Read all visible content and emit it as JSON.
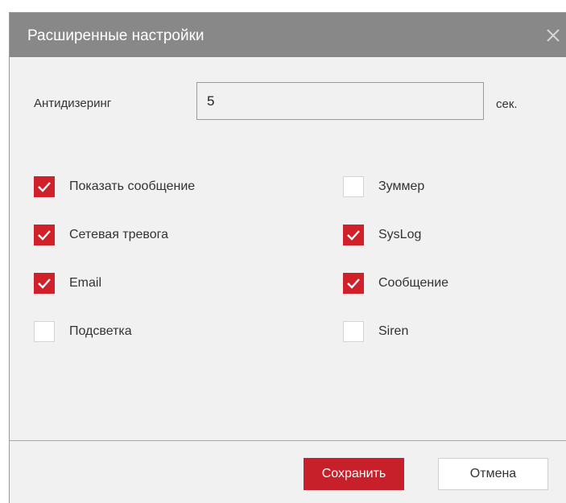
{
  "dialog": {
    "title": "Расширенные настройки"
  },
  "antidither": {
    "label": "Антидизеринг",
    "value": "5",
    "unit": "сек."
  },
  "options": {
    "show_message": {
      "label": "Показать сообщение",
      "checked": true
    },
    "network_alarm": {
      "label": "Сетевая тревога",
      "checked": true
    },
    "email": {
      "label": "Email",
      "checked": true
    },
    "backlight": {
      "label": "Подсветка",
      "checked": false
    },
    "buzzer": {
      "label": "Зуммер",
      "checked": false
    },
    "syslog": {
      "label": "SysLog",
      "checked": true
    },
    "message": {
      "label": "Сообщение",
      "checked": true
    },
    "siren": {
      "label": "Siren",
      "checked": false
    }
  },
  "buttons": {
    "save": "Сохранить",
    "cancel": "Отмена"
  },
  "colors": {
    "accent": "#d0202a",
    "titlebar": "#888888",
    "dialog_bg": "#f1f1f1"
  },
  "icons": {
    "close": "close-icon",
    "check": "checkmark-icon"
  }
}
